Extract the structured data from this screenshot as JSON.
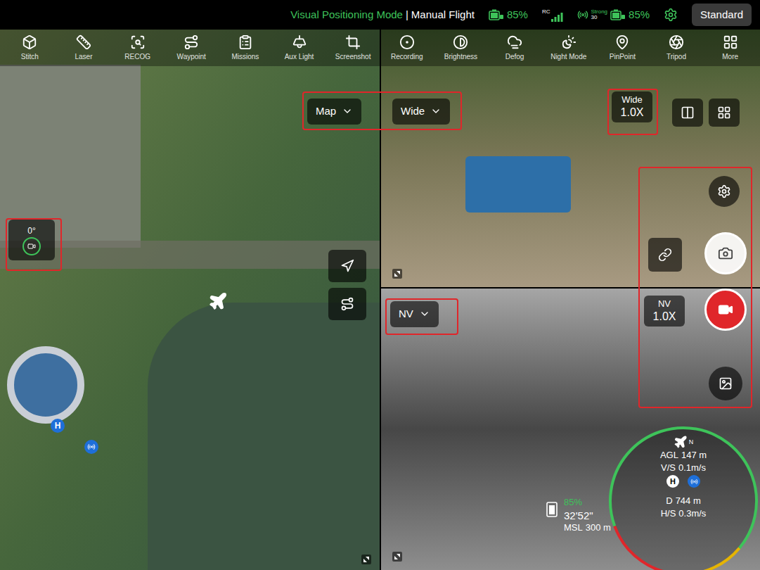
{
  "status_bar": {
    "mode": "Visual Positioning Mode",
    "separator": "|",
    "flight": "Manual Flight",
    "aircraft_battery": "85%",
    "rc_label": "RC",
    "video_signal_label": "Strong",
    "video_signal_value": "30",
    "rc_battery": "85%",
    "profile": "Standard"
  },
  "toolbar": [
    {
      "label": "Stitch"
    },
    {
      "label": "Laser"
    },
    {
      "label": "RECOG"
    },
    {
      "label": "Waypoint"
    },
    {
      "label": "Missions"
    },
    {
      "label": "Aux Light"
    },
    {
      "label": "Screenshot"
    },
    {
      "label": "Recording"
    },
    {
      "label": "Brightness"
    },
    {
      "label": "Defog"
    },
    {
      "label": "Night Mode"
    },
    {
      "label": "PinPoint"
    },
    {
      "label": "Tripod"
    },
    {
      "label": "More"
    }
  ],
  "map_panel": {
    "source": "Map",
    "gimbal_angle": "0°",
    "home_marker": "H"
  },
  "top_pane": {
    "source": "Wide",
    "zoom_lens": "Wide",
    "zoom": "1.0X"
  },
  "bottom_pane": {
    "source": "NV",
    "zoom_lens": "NV",
    "zoom": "1.0X"
  },
  "telemetry": {
    "north": "N",
    "agl_label": "AGL",
    "agl": "147 m",
    "vs_label": "V/S",
    "vs": "0.1m/s",
    "home": "H",
    "d_label": "D",
    "d": "744 m",
    "hs_label": "H/S",
    "hs": "0.3m/s",
    "battery": "85%",
    "flight_time": "32'52\"",
    "msl_label": "MSL",
    "msl": "300 m"
  }
}
